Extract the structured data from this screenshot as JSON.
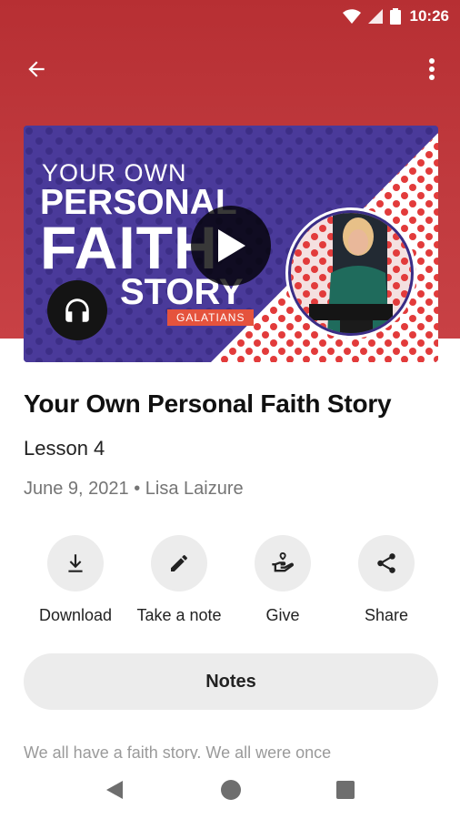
{
  "status_bar": {
    "time": "10:26",
    "icons": [
      "wifi-icon",
      "signal-icon",
      "battery-icon"
    ]
  },
  "toolbar": {
    "back_icon": "arrow-left-icon",
    "menu_icon": "more-vertical-icon"
  },
  "thumbnail": {
    "line1": "YOUR OWN",
    "line2": "PERSONAL",
    "line3": "FAITH",
    "line4": "STORY",
    "tag": "GALATIANS",
    "play_icon": "play-icon",
    "audio_icon": "headphones-icon"
  },
  "episode": {
    "title": "Your Own Personal Faith Story",
    "subtitle": "Lesson 4",
    "meta": "June 9, 2021 • Lisa Laizure"
  },
  "actions": [
    {
      "label": "Download",
      "icon": "download-icon"
    },
    {
      "label": "Take a note",
      "icon": "pencil-icon"
    },
    {
      "label": "Give",
      "icon": "give-hand-heart-icon"
    },
    {
      "label": "Share",
      "icon": "share-icon"
    }
  ],
  "notes_button": {
    "label": "Notes"
  },
  "description": "We all have a faith story. We all were once",
  "colors": {
    "header": "#c13b3f",
    "thumbnail_purple": "#4a3a9a",
    "thumbnail_dots": "#e03a3a",
    "tag_bg": "#e5533d",
    "button_bg": "#ececec"
  }
}
